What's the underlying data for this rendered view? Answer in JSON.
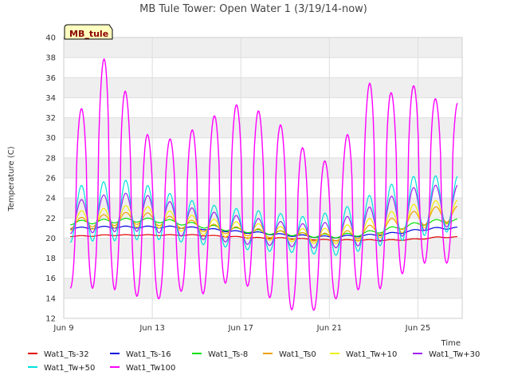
{
  "chart_data": {
    "type": "line",
    "title": "MB Tule Tower: Open Water 1 (3/19/14-now)",
    "xlabel": "Time",
    "ylabel": "Temperature (C)",
    "station_tag": "MB_tule",
    "xlim": [
      "2014-06-09",
      "2014-06-27"
    ],
    "ylim": [
      12,
      40
    ],
    "y_ticks": [
      12,
      14,
      16,
      18,
      20,
      22,
      24,
      26,
      28,
      30,
      32,
      34,
      36,
      38,
      40
    ],
    "x_ticks": [
      {
        "label": "Jun 9",
        "date": "2014-06-09"
      },
      {
        "label": "Jun 13",
        "date": "2014-06-13"
      },
      {
        "label": "Jun 17",
        "date": "2014-06-17"
      },
      {
        "label": "Jun 21",
        "date": "2014-06-21"
      },
      {
        "label": "Jun 25",
        "date": "2014-06-25"
      }
    ],
    "grid": true,
    "legend_position": "bottom",
    "x": [
      "2014-06-09",
      "2014-06-10",
      "2014-06-11",
      "2014-06-12",
      "2014-06-13",
      "2014-06-14",
      "2014-06-15",
      "2014-06-16",
      "2014-06-17",
      "2014-06-18",
      "2014-06-19",
      "2014-06-20",
      "2014-06-21",
      "2014-06-22",
      "2014-06-23",
      "2014-06-24",
      "2014-06-25",
      "2014-06-26"
    ],
    "series": [
      {
        "name": "Wat1_Ts-32",
        "color": "#e00000",
        "mean": [
          20.2,
          20.2,
          20.3,
          20.3,
          20.3,
          20.3,
          20.3,
          20.2,
          20.1,
          20.0,
          20.0,
          19.9,
          19.8,
          19.8,
          19.8,
          19.8,
          19.9,
          20.1
        ],
        "amplitude": [
          0.05,
          0.05,
          0.05,
          0.05,
          0.05,
          0.05,
          0.05,
          0.05,
          0.05,
          0.05,
          0.05,
          0.05,
          0.05,
          0.05,
          0.05,
          0.05,
          0.05,
          0.05
        ]
      },
      {
        "name": "Wat1_Ts-16",
        "color": "#0000e0",
        "mean": [
          21.0,
          21.0,
          21.1,
          21.1,
          21.1,
          21.1,
          21.0,
          20.8,
          20.6,
          20.5,
          20.3,
          20.2,
          20.1,
          20.2,
          20.3,
          20.5,
          20.8,
          21.0
        ],
        "amplitude": [
          0.1,
          0.1,
          0.1,
          0.1,
          0.1,
          0.1,
          0.1,
          0.1,
          0.1,
          0.1,
          0.1,
          0.1,
          0.1,
          0.1,
          0.1,
          0.1,
          0.1,
          0.1
        ]
      },
      {
        "name": "Wat1_Ts-8",
        "color": "#00e000",
        "mean": [
          21.5,
          21.6,
          21.7,
          21.8,
          21.8,
          21.6,
          21.3,
          21.0,
          20.8,
          20.6,
          20.5,
          20.3,
          20.2,
          20.3,
          20.6,
          21.0,
          21.4,
          21.7
        ],
        "amplitude": [
          0.2,
          0.2,
          0.2,
          0.2,
          0.2,
          0.2,
          0.2,
          0.2,
          0.2,
          0.2,
          0.2,
          0.2,
          0.2,
          0.2,
          0.2,
          0.2,
          0.2,
          0.2
        ]
      },
      {
        "name": "Wat1_Ts0",
        "color": "#f0a000",
        "mean": [
          21.4,
          21.6,
          21.8,
          22.0,
          21.9,
          21.6,
          21.2,
          20.9,
          20.7,
          20.5,
          20.3,
          20.1,
          20.1,
          20.3,
          20.8,
          21.4,
          22.0,
          22.4
        ],
        "amplitude": [
          0.5,
          0.5,
          0.6,
          0.6,
          0.6,
          0.5,
          0.5,
          0.4,
          0.4,
          0.4,
          0.4,
          0.4,
          0.4,
          0.5,
          0.6,
          0.7,
          0.8,
          0.8
        ]
      },
      {
        "name": "Wat1_Tw+10",
        "color": "#f0f000",
        "mean": [
          21.6,
          21.8,
          22.0,
          22.2,
          22.1,
          21.7,
          21.3,
          21.0,
          20.8,
          20.6,
          20.4,
          20.2,
          20.2,
          20.5,
          21.0,
          21.6,
          22.2,
          22.6
        ],
        "amplitude": [
          0.9,
          1.0,
          1.0,
          1.1,
          1.0,
          0.9,
          0.9,
          0.8,
          0.8,
          0.8,
          0.7,
          0.7,
          0.8,
          0.9,
          1.1,
          1.2,
          1.3,
          1.2
        ]
      },
      {
        "name": "Wat1_Tw+30",
        "color": "#a020f0",
        "mean": [
          22.0,
          22.2,
          22.5,
          22.6,
          22.4,
          21.9,
          21.4,
          21.1,
          20.8,
          20.6,
          20.4,
          20.2,
          20.3,
          20.7,
          21.4,
          22.2,
          22.9,
          23.2
        ],
        "amplitude": [
          1.6,
          1.7,
          1.9,
          1.9,
          1.8,
          1.6,
          1.5,
          1.4,
          1.4,
          1.3,
          1.2,
          1.2,
          1.3,
          1.6,
          1.9,
          2.2,
          2.3,
          2.1
        ]
      },
      {
        "name": "Wat1_Tw+50",
        "color": "#00e0e0",
        "mean": [
          22.3,
          22.5,
          22.7,
          22.8,
          22.5,
          22.0,
          21.5,
          21.2,
          20.9,
          20.7,
          20.5,
          20.3,
          20.4,
          20.9,
          21.8,
          22.6,
          23.2,
          23.4
        ],
        "amplitude": [
          2.8,
          2.8,
          3.0,
          3.0,
          2.6,
          2.3,
          2.1,
          2.0,
          2.0,
          2.0,
          1.9,
          1.8,
          2.2,
          2.4,
          2.7,
          3.0,
          3.1,
          2.8
        ]
      },
      {
        "name": "Wat1_Tw100",
        "color": "#ff00ff",
        "mean": [
          23.8,
          24.0,
          27.0,
          24.0,
          21.5,
          22.5,
          22.5,
          24.0,
          24.5,
          23.5,
          22.0,
          20.5,
          20.5,
          23.0,
          25.5,
          25.0,
          26.5,
          25.5
        ],
        "amplitude": [
          8.8,
          9.0,
          12.0,
          9.5,
          8.0,
          7.5,
          8.5,
          8.5,
          9.0,
          9.0,
          9.0,
          8.0,
          7.0,
          8.0,
          11.0,
          9.0,
          9.0,
          8.0
        ]
      }
    ]
  }
}
